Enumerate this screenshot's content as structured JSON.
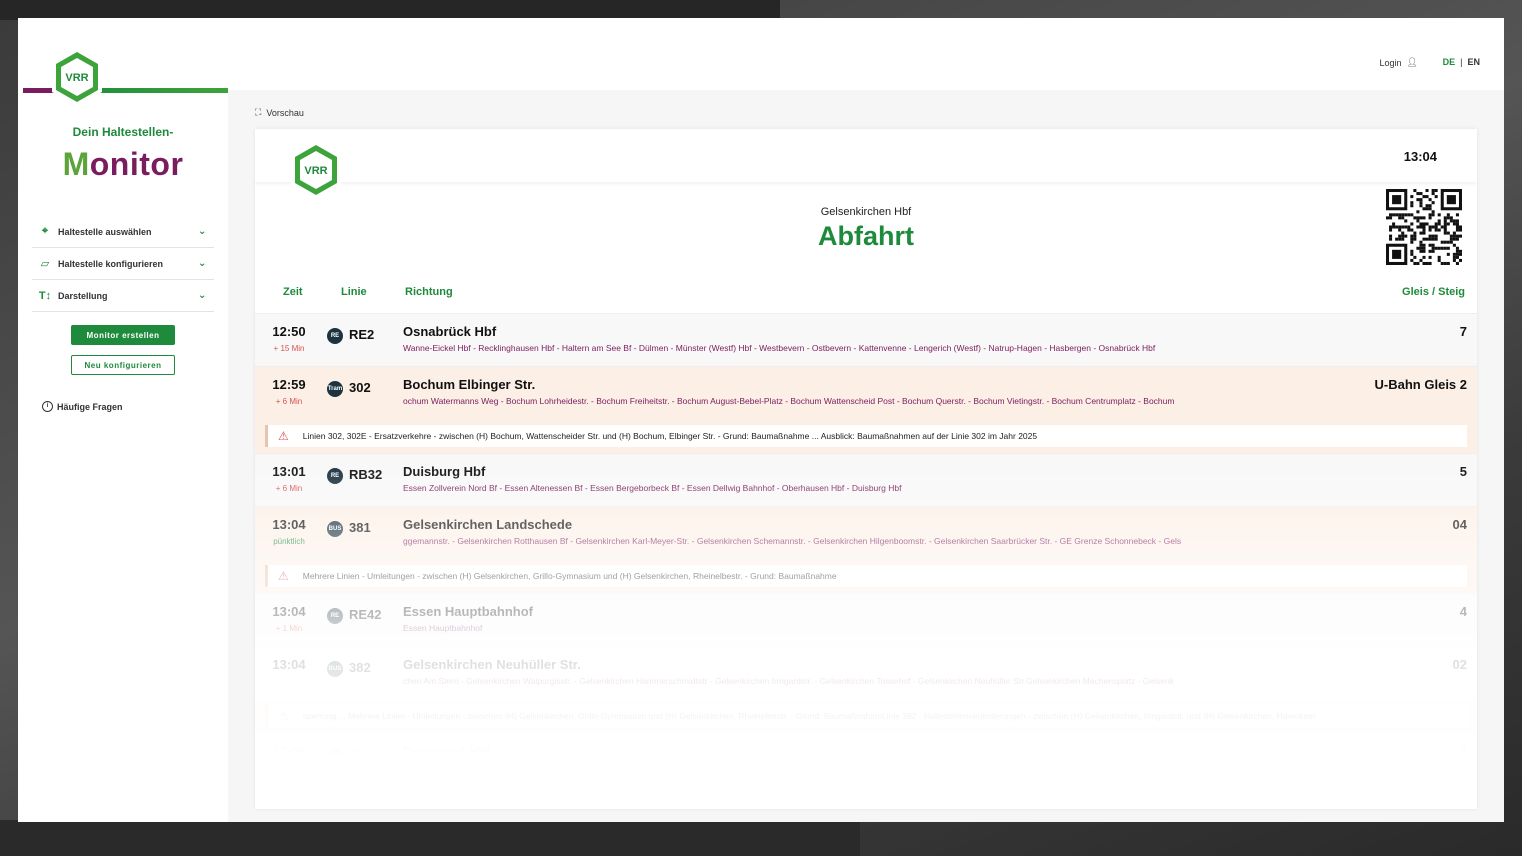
{
  "brand": {
    "logo_text": "VRR",
    "tagline": "Dein Haltestellen-",
    "title_part1": "M",
    "title_part2": "o",
    "title_part3": "nitor"
  },
  "sidebar": {
    "menu": [
      {
        "label": "Haltestelle auswählen",
        "icon": "location-pin-icon"
      },
      {
        "label": "Haltestelle konfigurieren",
        "icon": "map-icon"
      },
      {
        "label": "Darstellung",
        "icon": "text-size-icon"
      }
    ],
    "create_button": "Monitor erstellen",
    "reconfigure_button": "Neu konfigurieren",
    "faq": "Häufige Fragen"
  },
  "header": {
    "login": "Login",
    "lang_de": "DE",
    "lang_sep": "|",
    "lang_en": "EN"
  },
  "preview": {
    "label": "Vorschau"
  },
  "monitor": {
    "clock": "13:04",
    "station": "Gelsenkirchen Hbf",
    "heading": "Abfahrt",
    "columns": {
      "time": "Zeit",
      "line": "Linie",
      "direction": "Richtung",
      "platform": "Gleis / Steig"
    },
    "departures": [
      {
        "time": "12:50",
        "delay": "+ 15 Min",
        "type": "RE",
        "line": "RE2",
        "dest": "Osnabrück Hbf",
        "via": "Wanne-Eickel Hbf - Recklinghausen Hbf - Haltern am See Bf - Dülmen - Münster (Westf) Hbf - Westbevern - Ostbevern - Kattenvenne - Lengerich (Westf) - Natrup-Hagen - Hasbergen - Osnabrück Hbf",
        "platform": "7"
      },
      {
        "time": "12:59",
        "delay": "+ 6 Min",
        "type": "Tram",
        "line": "302",
        "dest": "Bochum Elbinger Str.",
        "via": "ochum Watermanns Weg - Bochum Lohrheidestr. - Bochum Freiheitstr. - Bochum August-Bebel-Platz - Bochum Wattenscheid Post - Bochum Querstr. - Bochum Vietingstr. - Bochum Centrumplatz - Bochum",
        "platform": "U-Bahn Gleis 2"
      },
      {
        "time": "13:01",
        "delay": "+ 6 Min",
        "type": "RE",
        "line": "RB32",
        "dest": "Duisburg Hbf",
        "via": "Essen Zollverein Nord Bf - Essen Altenessen Bf - Essen Bergeborbeck Bf - Essen Dellwig Bahnhof - Oberhausen Hbf - Duisburg Hbf",
        "platform": "5"
      },
      {
        "time": "13:04",
        "delay": "pünktlich",
        "type": "BUS",
        "line": "381",
        "dest": "Gelsenkirchen Landschede",
        "via": "ggemannstr. - Gelsenkirchen Rotthausen Bf - Gelsenkirchen Karl-Meyer-Str. - Gelsenkirchen Schemannstr. - Gelsenkirchen Hilgenboomstr. - Gelsenkirchen Saarbrücker Str. - GE Grenze Schonnebeck - Gels",
        "platform": "04"
      },
      {
        "time": "13:04",
        "delay": "+ 1 Min",
        "type": "RE",
        "line": "RE42",
        "dest": "Essen Hauptbahnhof",
        "via": "Essen Hauptbahnhof",
        "platform": "4"
      },
      {
        "time": "13:04",
        "delay": "",
        "type": "BUS",
        "line": "382",
        "dest": "Gelsenkirchen Neuhüller Str.",
        "via": "chen Am Stern - Gelsenkirchen Walpurgisstr. - Gelsenkirchen Hammerschmidtstr - Gelsenkirchen Irmgardstr. - Gelsenkirchen Tossehof - Gelsenkirchen Neuhüller Str.Gelsenkirchen Machensplatz - Gelsenk",
        "platform": "02"
      },
      {
        "time": "13:05",
        "delay": "",
        "type": "S",
        "line": "S2",
        "dest": "Dortmund Hbf",
        "via": "",
        "platform": "6"
      }
    ],
    "alerts": [
      "Linien 302, 302E - Ersatzverkehre - zwischen (H) Bochum, Wattenscheider Str. und (H) Bochum, Elbinger Str. - Grund: Baumaßnahme ... Ausblick: Baumaßnahmen auf der Linie 302 im Jahr 2025",
      "Mehrere Linien - Umleitungen - zwischen (H) Gelsenkirchen, Grillo-Gymnasium und (H) Gelsenkirchen, Rheinelbestr. - Grund: Baumaßnahme",
      "sperrung ... Mehrere Linien - Umleitungen - zwischen (H) Gelsenkirchen, Grillo-Gymnasium und (H) Gelsenkirchen, Rheinelbestr. - Grund: BaumaßnahmeLinie 382 - Haltestellenveränderungen - zwischen (H) Gelsenkirchen, Irmgardstr. und (H) Gelsenkirchen, Haverkam"
    ]
  },
  "colors": {
    "brand_green": "#1e8a3c",
    "brand_purple": "#7a1d5e",
    "delay_red": "#d9534f",
    "highlight_bg": "#fcefe6"
  }
}
